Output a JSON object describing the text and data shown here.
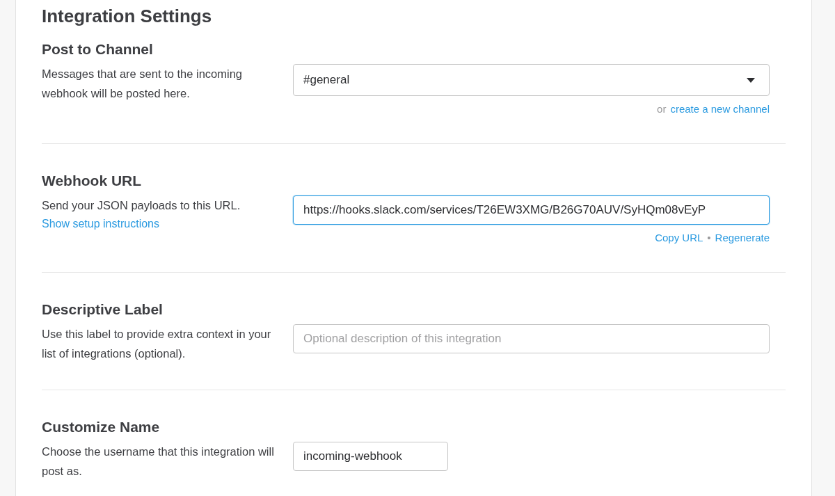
{
  "page_title": "Integration Settings",
  "sections": [
    {
      "title": "Post to Channel",
      "description": "Messages that are sent to the incoming webhook will be posted here.",
      "field": {
        "kind": "select",
        "value": "#general",
        "focused": false
      },
      "actions": [
        {
          "kind": "text",
          "text": "or"
        },
        {
          "kind": "link",
          "text": "create a new channel"
        }
      ]
    },
    {
      "title": "Webhook URL",
      "description": "Send your JSON payloads to this URL.",
      "link": "Show setup instructions",
      "field": {
        "kind": "text",
        "value": "https://hooks.slack.com/services/T26EW3XMG/B26G70AUV/SyHQm08vEyP",
        "focused": true
      },
      "actions": [
        {
          "kind": "link",
          "text": "Copy URL"
        },
        {
          "kind": "separator",
          "text": "•"
        },
        {
          "kind": "link",
          "text": "Regenerate"
        }
      ]
    },
    {
      "title": "Descriptive Label",
      "description": "Use this label to provide extra context in your list of integrations (optional).",
      "field": {
        "kind": "text",
        "placeholder": "Optional description of this integration",
        "focused": false
      }
    },
    {
      "title": "Customize Name",
      "description": "Choose the username that this integration will post as.",
      "field": {
        "kind": "short",
        "value": "incoming-webhook",
        "focused": false
      }
    }
  ]
}
